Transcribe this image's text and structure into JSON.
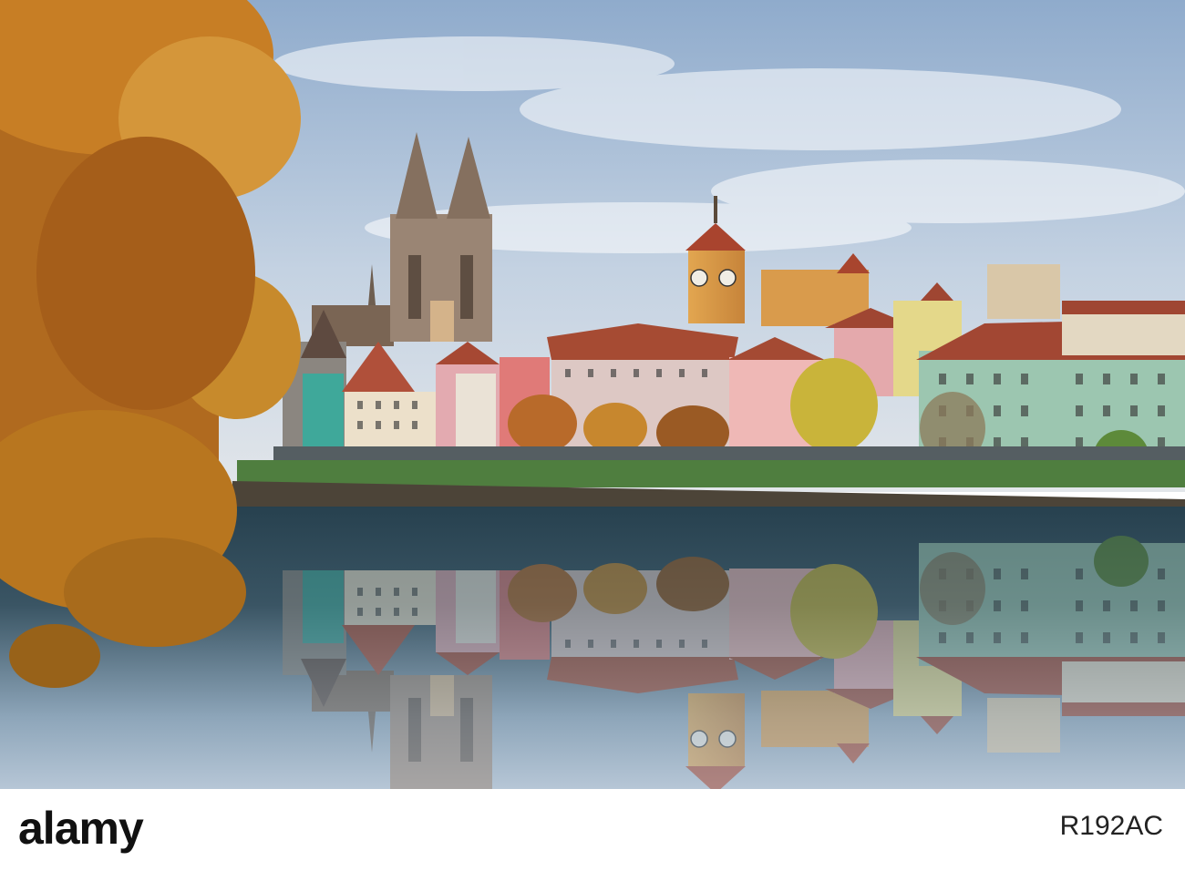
{
  "footer": {
    "logo_text": "alamy",
    "image_ref": "R192AC"
  },
  "clock_faces": [
    "clock-face-left",
    "clock-face-right"
  ],
  "colors": {
    "sky_top": "#9cb6d4",
    "sky_bottom": "#dce4ec",
    "river": "#1e3c4e",
    "foliage": "#c47d20",
    "cathedral": "#8d7a68",
    "tower_sunlit": "#e4a04a",
    "quay_wall": "#4c4438",
    "grass": "#4e7c3e"
  }
}
